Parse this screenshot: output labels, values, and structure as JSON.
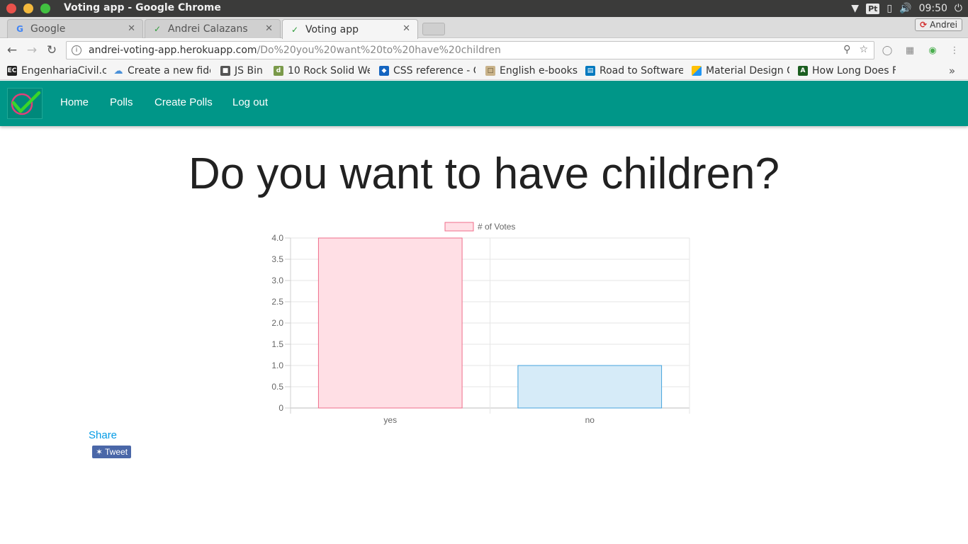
{
  "window": {
    "title": "Voting app - Google Chrome"
  },
  "tray": {
    "lang": "Pt",
    "time": "09:50"
  },
  "tabs": [
    {
      "label": "Google",
      "favicon": "google-icon"
    },
    {
      "label": "Andrei Calazans",
      "favicon": "checkmark-icon"
    },
    {
      "label": "Voting app",
      "favicon": "checkmark-icon",
      "active": true
    }
  ],
  "profile": {
    "name": "Andrei"
  },
  "omnibox": {
    "host": "andrei-voting-app.herokuapp.com",
    "path": "/Do%20you%20want%20to%20have%20children"
  },
  "bookmarks": [
    {
      "label": "EngenhariaCivil.c",
      "color": "#222222"
    },
    {
      "label": "Create a new fidd",
      "color": "#4a90d9"
    },
    {
      "label": "JS Bin",
      "color": "#555555"
    },
    {
      "label": "10 Rock Solid We",
      "color": "#7a9a4a"
    },
    {
      "label": "CSS reference - C",
      "color": "#1565c0"
    },
    {
      "label": "English e-books",
      "color": "#9e7b4f"
    },
    {
      "label": "Road to Software",
      "color": "#0079bf"
    },
    {
      "label": "Material Design C",
      "color": "#ffc107"
    },
    {
      "label": "How Long Does F",
      "color": "#1b5e20"
    }
  ],
  "app": {
    "nav": {
      "home": "Home",
      "polls": "Polls",
      "create": "Create Polls",
      "logout": "Log out"
    },
    "title": "Do you want to have children?",
    "share": "Share",
    "tweet": "Tweet"
  },
  "chart_data": {
    "type": "bar",
    "categories": [
      "yes",
      "no"
    ],
    "series": [
      {
        "name": "# of Votes",
        "values": [
          4,
          1
        ]
      }
    ],
    "bar_fills": [
      "#ffdfe5",
      "#d6ebf8"
    ],
    "bar_strokes": [
      "#ef6c8a",
      "#45a3dc"
    ],
    "ylim": [
      0,
      4
    ],
    "yticks": [
      "0",
      "0.5",
      "1.0",
      "1.5",
      "2.0",
      "2.5",
      "3.0",
      "3.5",
      "4.0"
    ],
    "grid": true,
    "legend": "top"
  },
  "colors": {
    "primary": "#009688",
    "link": "#039be5",
    "tweet": "#4a67a8"
  }
}
